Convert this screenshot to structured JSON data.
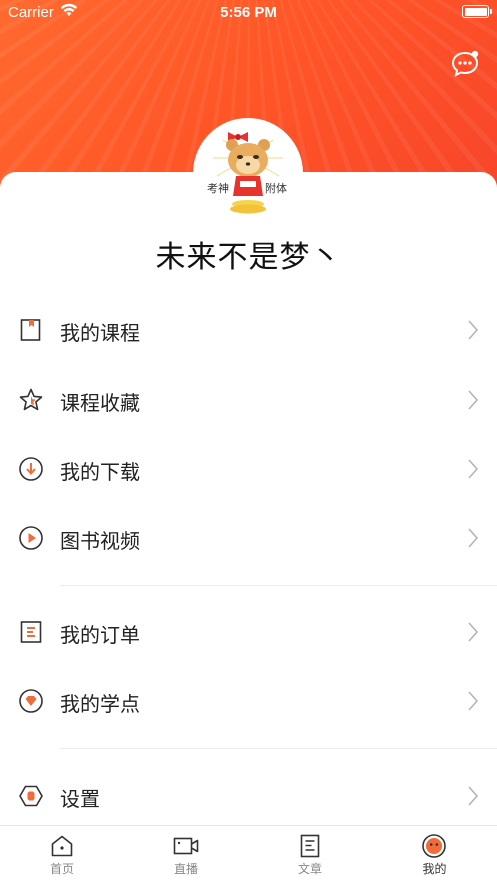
{
  "status_bar": {
    "carrier": "Carrier",
    "time": "5:56 PM"
  },
  "profile": {
    "username": "未来不是梦丶",
    "avatar_text_left": "考神",
    "avatar_text_right": "附体"
  },
  "menu": {
    "my_courses": "我的课程",
    "favorites": "课程收藏",
    "downloads": "我的下载",
    "book_videos": "图书视频",
    "orders": "我的订单",
    "points": "我的学点",
    "settings": "设置"
  },
  "tabbar": {
    "home": "首页",
    "live": "直播",
    "articles": "文章",
    "mine": "我的"
  },
  "colors": {
    "accent": "#ff5a2c",
    "icon_orange": "#f26b3a"
  }
}
